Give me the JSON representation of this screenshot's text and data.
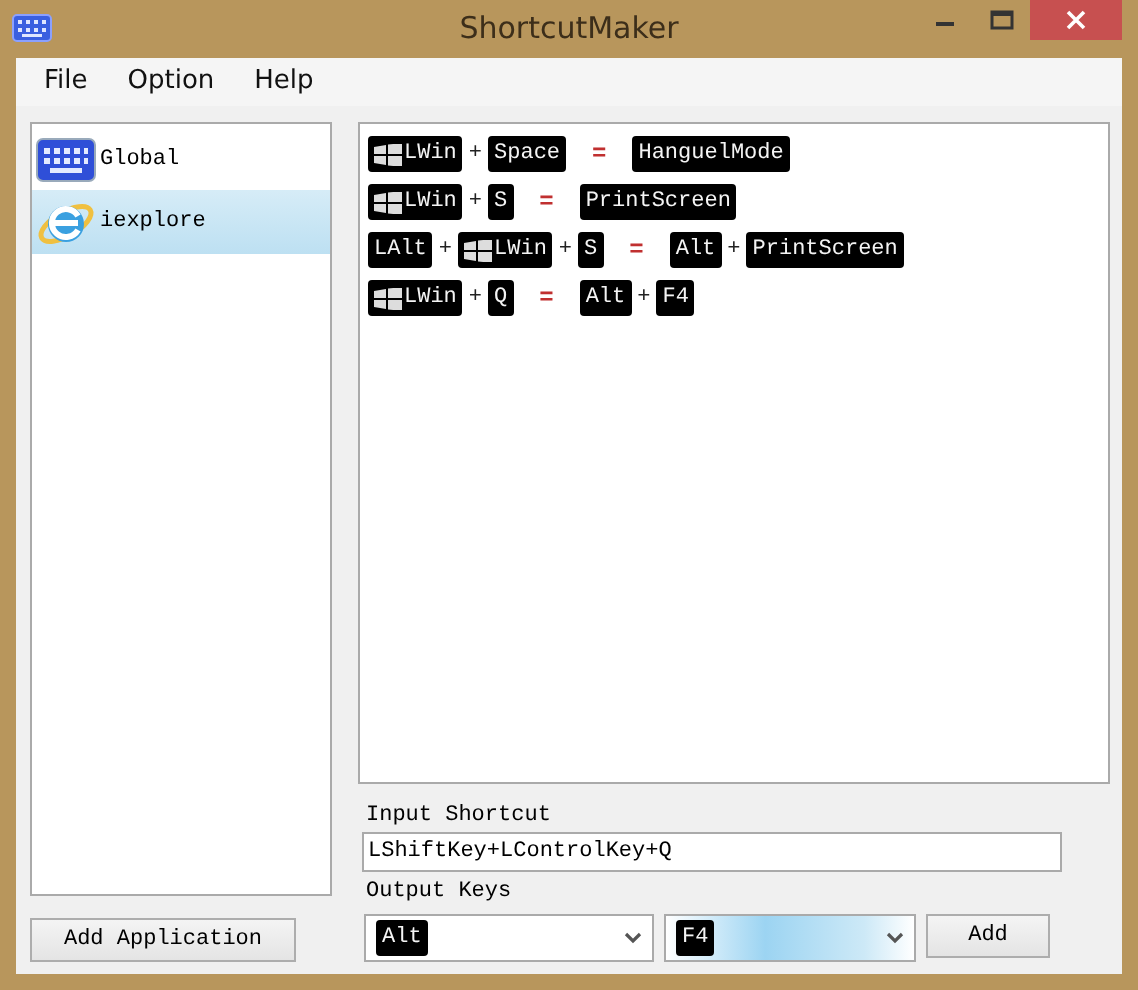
{
  "window": {
    "title": "ShortcutMaker"
  },
  "menu": [
    "File",
    "Option",
    "Help"
  ],
  "applications": [
    {
      "name": "Global",
      "kind": "keyboard",
      "selected": false
    },
    {
      "name": "iexplore",
      "kind": "browser",
      "selected": true
    }
  ],
  "mappings": [
    {
      "input": [
        {
          "label": "LWin",
          "kind": "win"
        },
        {
          "label": "Space",
          "kind": "key"
        }
      ],
      "output": [
        {
          "label": "HanguelMode",
          "kind": "key"
        }
      ]
    },
    {
      "input": [
        {
          "label": "LWin",
          "kind": "win"
        },
        {
          "label": "S",
          "kind": "key"
        }
      ],
      "output": [
        {
          "label": "PrintScreen",
          "kind": "key"
        }
      ]
    },
    {
      "input": [
        {
          "label": "LAlt",
          "kind": "key"
        },
        {
          "label": "LWin",
          "kind": "win"
        },
        {
          "label": "S",
          "kind": "key"
        }
      ],
      "output": [
        {
          "label": "Alt",
          "kind": "key"
        },
        {
          "label": "PrintScreen",
          "kind": "key"
        }
      ]
    },
    {
      "input": [
        {
          "label": "LWin",
          "kind": "win"
        },
        {
          "label": "Q",
          "kind": "key"
        }
      ],
      "output": [
        {
          "label": "Alt",
          "kind": "key"
        },
        {
          "label": "F4",
          "kind": "key"
        }
      ]
    }
  ],
  "plus": "+",
  "equals": "=",
  "input_shortcut": {
    "label": "Input Shortcut",
    "value": "LShiftKey+LControlKey+Q"
  },
  "output_keys": {
    "label": "Output Keys",
    "dropdowns": [
      {
        "value": "Alt",
        "highlighted": false
      },
      {
        "value": "F4",
        "highlighted": true
      }
    ]
  },
  "buttons": {
    "add_application": "Add Application",
    "add": "Add"
  }
}
